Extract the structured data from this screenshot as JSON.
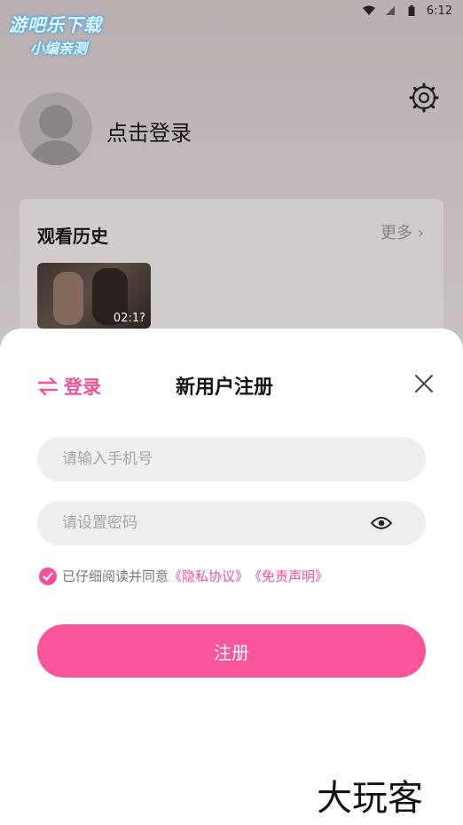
{
  "status_bar": {
    "time": "6:12"
  },
  "watermark": {
    "line1": "游吧乐下载",
    "line2": "小编亲测"
  },
  "profile": {
    "login_text": "点击登录"
  },
  "history": {
    "title": "观看历史",
    "more_label": "更多",
    "items": [
      {
        "duration": "02:1?"
      }
    ]
  },
  "sheet": {
    "switch_label": "登录",
    "title": "新用户注册",
    "phone_placeholder": "请输入手机号",
    "password_placeholder": "请设置密码",
    "agree_text": "已仔细阅读并同意",
    "privacy_link": "《隐私协议》",
    "disclaimer_link": "《免责声明》",
    "submit_label": "注册"
  },
  "brand": {
    "text": "大玩客"
  },
  "colors": {
    "accent": "#f4519b",
    "button": "#f8559b"
  }
}
